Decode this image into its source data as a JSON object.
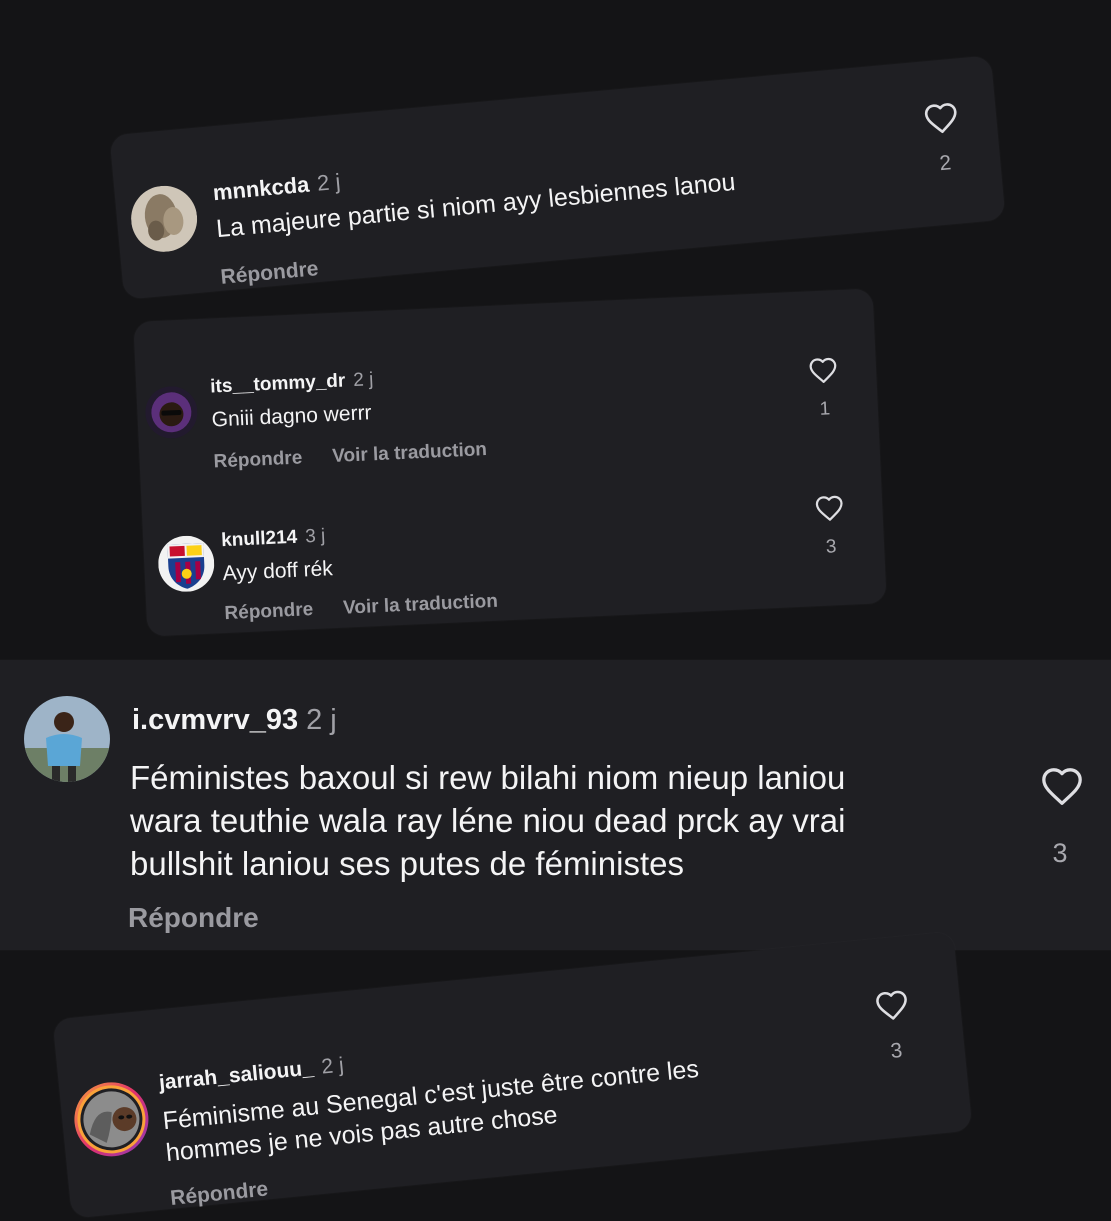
{
  "reply_label": "Répondre",
  "translate_label": "Voir la traduction",
  "comments": [
    {
      "username": "mnnkcda",
      "time": "2 j",
      "lines": [
        "La majeure partie si niom ayy lesbiennes lanou"
      ],
      "likes": "2"
    },
    {
      "username": "its__tommy_dr",
      "time": "2 j",
      "lines": [
        "Gniii dagno werrr"
      ],
      "likes": "1"
    },
    {
      "username": "knull214",
      "time": "3 j",
      "lines": [
        "Ayy doff rék"
      ],
      "likes": "3"
    },
    {
      "username": "i.cvmvrv_93",
      "time": "2 j",
      "lines": [
        "Féministes baxoul si rew bilahi niom nieup laniou",
        "wara teuthie wala ray léne niou dead prck ay vrai",
        "bullshit laniou ses putes de féministes"
      ],
      "likes": "3"
    },
    {
      "username": "jarrah_saliouu_",
      "time": "2 j",
      "lines": [
        "Féminisme au Senegal c'est juste être contre les",
        "hommes je ne vois pas autre chose"
      ],
      "likes": "3"
    }
  ]
}
